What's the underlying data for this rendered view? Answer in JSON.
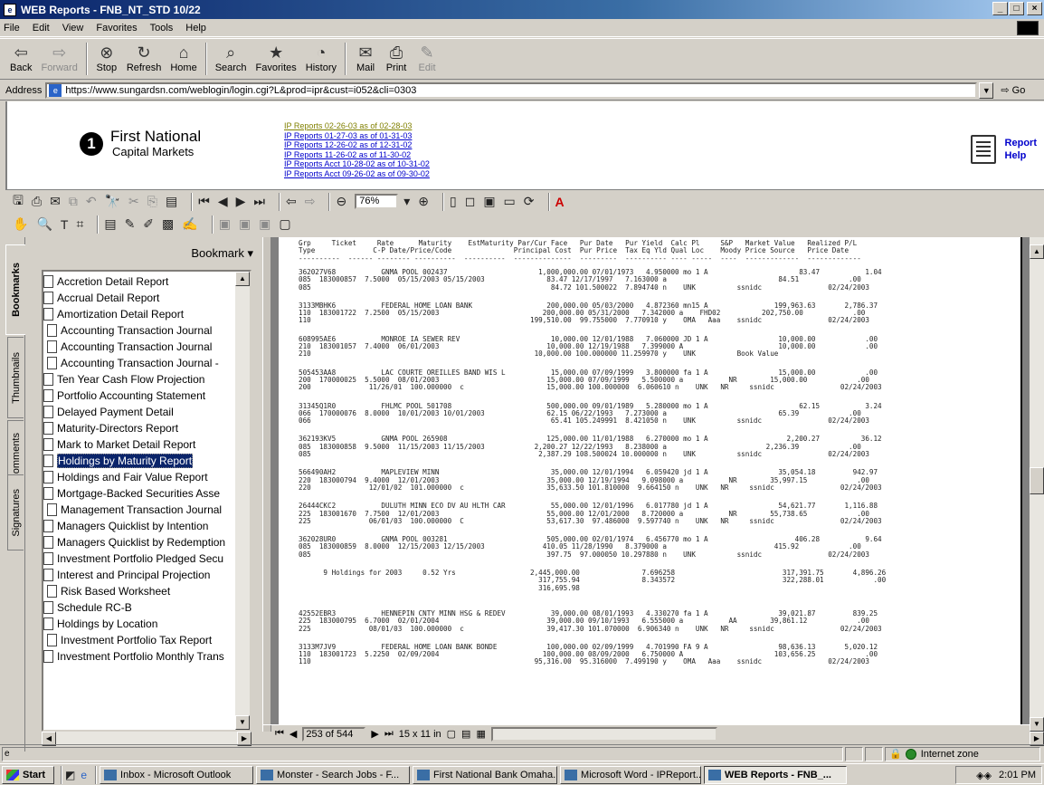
{
  "window": {
    "title": "WEB Reports - FNB_NT_STD 10/22",
    "buttons": [
      "_",
      "□",
      "×"
    ]
  },
  "menu": [
    "File",
    "Edit",
    "View",
    "Favorites",
    "Tools",
    "Help"
  ],
  "toolbar": [
    {
      "label": "Back",
      "glyph": "⇦",
      "disabled": false
    },
    {
      "label": "Forward",
      "glyph": "⇨",
      "disabled": true
    },
    {
      "label": "Stop",
      "glyph": "⊗",
      "disabled": false
    },
    {
      "label": "Refresh",
      "glyph": "↻",
      "disabled": false
    },
    {
      "label": "Home",
      "glyph": "⌂",
      "disabled": false
    },
    {
      "label": "Search",
      "glyph": "⌕",
      "disabled": false
    },
    {
      "label": "Favorites",
      "glyph": "★",
      "disabled": false
    },
    {
      "label": "History",
      "glyph": "◔",
      "disabled": false
    },
    {
      "label": "Mail",
      "glyph": "✉",
      "disabled": false
    },
    {
      "label": "Print",
      "glyph": "⎙",
      "disabled": false
    },
    {
      "label": "Edit",
      "glyph": "✎",
      "disabled": true
    }
  ],
  "address": {
    "label": "Address",
    "url": "https://www.sungardsn.com/weblogin/login.cgi?L&prod=ipr&cust=i052&cli=0303",
    "go": "Go"
  },
  "web": {
    "brand_line1": "First National",
    "brand_line2": "Capital Markets",
    "links": [
      "IP Reports  02-26-03  as of 02-28-03",
      "IP Reports  01-27-03  as of 01-31-03",
      "IP Reports  12-26-02  as of 12-31-02",
      "IP Reports  11-26-02  as of 11-30-02",
      "IP Reports Acct 10-28-02  as of 10-31-02",
      "IP Reports Acct 09-26-02  as of 09-30-02"
    ],
    "help_line1": "Report",
    "help_line2": "Help"
  },
  "acrobat": {
    "zoom": "76%"
  },
  "sidetabs": [
    "Bookmarks",
    "Thumbnails",
    "Comments",
    "Signatures"
  ],
  "bookmarks": {
    "header": "Bookmark ▾",
    "items": [
      {
        "label": "Accretion Detail Report",
        "indent": false,
        "selected": false
      },
      {
        "label": "Accrual Detail Report",
        "indent": false,
        "selected": false
      },
      {
        "label": "Amortization Detail Report",
        "indent": false,
        "selected": false
      },
      {
        "label": "Accounting Transaction Journal",
        "indent": true,
        "selected": false
      },
      {
        "label": "Accounting Transaction Journal",
        "indent": true,
        "selected": false
      },
      {
        "label": "Accounting Transaction Journal -",
        "indent": true,
        "selected": false
      },
      {
        "label": "Ten Year Cash Flow Projection",
        "indent": false,
        "selected": false
      },
      {
        "label": "Portfolio Accounting Statement",
        "indent": false,
        "selected": false
      },
      {
        "label": "Delayed Payment Detail",
        "indent": false,
        "selected": false
      },
      {
        "label": "Maturity-Directors Report",
        "indent": false,
        "selected": false
      },
      {
        "label": "Mark to Market Detail Report",
        "indent": false,
        "selected": false
      },
      {
        "label": "Holdings by Maturity Report",
        "indent": false,
        "selected": true
      },
      {
        "label": "Holdings and Fair Value Report",
        "indent": false,
        "selected": false
      },
      {
        "label": "Mortgage-Backed Securities Asse",
        "indent": false,
        "selected": false
      },
      {
        "label": "Management Transaction Journal",
        "indent": true,
        "selected": false
      },
      {
        "label": "Managers Quicklist by Intention",
        "indent": false,
        "selected": false
      },
      {
        "label": "Managers Quicklist by Redemption",
        "indent": false,
        "selected": false
      },
      {
        "label": "Investment Portfolio Pledged Secu",
        "indent": false,
        "selected": false
      },
      {
        "label": "Interest and Principal Projection",
        "indent": false,
        "selected": false
      },
      {
        "label": "Risk Based Worksheet",
        "indent": true,
        "selected": false
      },
      {
        "label": "Schedule RC-B",
        "indent": false,
        "selected": false
      },
      {
        "label": "Holdings by Location",
        "indent": false,
        "selected": false
      },
      {
        "label": "Investment Portfolio Tax Report",
        "indent": true,
        "selected": false
      },
      {
        "label": "Investment Portfolio Monthly Trans",
        "indent": false,
        "selected": false
      }
    ]
  },
  "report": {
    "header": [
      "Grp     Ticket     Rate      Maturity    EstMaturity Par/Cur Face   Pur Date   Pur Yield  Calc Pl     S&P   Market Value   Realized P/L",
      "Type              C-P Date/Price/Code               Principal Cost  Pur Price  Tax Eq Yld Qual Loc    Moody Price Source   Price Date",
      "----------  ------ -------- ----------  ----------  --------------  ---------  ---------- ---- -----  ----  -------------  -------------"
    ],
    "holdings": [
      [
        "362027V68           GNMA POOL 002437                      1,000,000.00 07/01/1973   4.950000 mo 1 A                      83.47           1.04",
        "085  183000857  7.5000  05/15/2003 05/15/2003               83.47 12/17/1997   7.163000 a                           84.51            .00",
        "085                                                          84.72 101.500022  7.894740 n    UNK          ssnidc                02/24/2003"
      ],
      [
        "3133MBHK6           FEDERAL HOME LOAN BANK                  200,000.00 05/03/2000   4.872360 mn15 A                199,963.63       2,786.37",
        "110  183001722  7.2500  05/15/2003                         200,000.00 05/31/2000   7.342000 a    FHD02          202,750.00            .00",
        "110                                                     199,510.00  99.755000  7.770910 y    OMA   Aaa    ssnidc                02/24/2003"
      ],
      [
        "608995AE6           MONROE IA SEWER REV                      10,000.00 12/01/1988   7.060000 JD 1 A                 10,000.00            .00",
        "210  183001057  7.4000  06/01/2003                          10,000.00 12/19/1988   7.399000 A                       10,000.00            .00",
        "210                                                      10,000.00 100.000000 11.259970 y    UNK          Book Value"
      ],
      [
        "505453AA8           LAC COURTE OREILLES BAND WIS L           15,000.00 07/09/1999   3.800000 fa 1 A                 15,000.00            .00",
        "200  170000025  5.5000  08/01/2003                          15,000.00 07/09/1999   5.500000 a           NR        15,000.00            .00",
        "200              11/26/01  100.000000  c                    15,000.00 100.000000  6.060610 n    UNK   NR     ssnidc                02/24/2003"
      ],
      [
        "31345Q1R0           FHLMC POOL 501708                       500,000.00 09/01/1989   5.280000 mo 1 A                      62.15           3.24",
        "066  170000076  8.0000  10/01/2003 10/01/2003               62.15 06/22/1993   7.273000 a                           65.39            .00",
        "066                                                          65.41 105.249991  8.421050 n    UNK          ssnidc                02/24/2003"
      ],
      [
        "362193KV5           GNMA POOL 265908                        125,000.00 11/01/1988   6.270000 mo 1 A                   2,200.27          36.12",
        "085  183000858  9.5000  11/15/2003 11/15/2003            2,200.27 12/22/1993   8.238000 a                        2,236.39            .00",
        "085                                                       2,387.29 108.500024 10.000000 n    UNK          ssnidc                02/24/2003"
      ],
      [
        "566490AH2           MAPLEVIEW MINN                           35,000.00 12/01/1994   6.059420 jd 1 A                 35,054.18         942.97",
        "220  183000794  9.4000  12/01/2003                          35,000.00 12/19/1994   9.098000 a           NR        35,997.15            .00",
        "220              12/01/02  101.000000  c                    35,633.50 101.810000  9.664150 n    UNK   NR     ssnidc                02/24/2003"
      ],
      [
        "26444CKC2           DULUTH MINN ECO DV AU HLTH CAR           55,000.00 12/01/1996   6.017780 jd 1 A                 54,621.77       1,116.88",
        "225  183001670  7.7500  12/01/2003                          55,000.00 12/01/2000   8.720000 a           NR        55,738.65            .00",
        "225              06/01/03  100.000000  C                    53,617.30  97.486000  9.597740 n    UNK   NR     ssnidc                02/24/2003"
      ],
      [
        "362028UR0           GNMA POOL 003281                        505,000.00 02/01/1974   6.456770 mo 1 A                     406.28           9.64",
        "085  183000859  8.0000  12/15/2003 12/15/2003              410.05 11/28/1990   8.379000 a                          415.92            .00",
        "085                                                         397.75  97.000050 10.297880 n    UNK          ssnidc                02/24/2003"
      ]
    ],
    "subtotal": [
      "      9 Holdings for 2003     0.52 Yrs                  2,445,000.00               7.696258                          317,391.75       4,896.26",
      "                                                          317,755.94               8.343572                          322,288.01            .00",
      "                                                          316,695.98"
    ],
    "holdings_2004": [
      [
        "42552EBR3           HENNEPIN CNTY MINN HSG & REDEV           39,000.00 08/01/1993   4.330270 fa 1 A                 39,021.87         839.25",
        "225  183000795  6.7000  02/01/2004                          39,000.00 09/10/1993   6.555000 a           AA        39,861.12            .00",
        "225              08/01/03  100.000000  c                    39,417.30 101.070000  6.906340 n    UNK   NR     ssnidc                02/24/2003"
      ],
      [
        "3133M7JV9           FEDERAL HOME LOAN BANK BONDE            100,000.00 02/09/1999   4.701990 FA 9 A                 98,636.13       5,020.12",
        "110  183001723  5.2250  02/09/2004                         100,000.00 08/09/2000   6.750000 A                      103,656.25            .00",
        "110                                                      95,316.00  95.316000  7.499190 y    OMA   Aaa    ssnidc                02/24/2003"
      ]
    ]
  },
  "docstatus": {
    "page": "253 of 544",
    "size": "15 x 11 in"
  },
  "iestatus": {
    "zone": "Internet zone"
  },
  "taskbar": {
    "start": "Start",
    "tasks": [
      {
        "label": "Inbox - Microsoft Outlook",
        "active": false
      },
      {
        "label": "Monster - Search Jobs - F...",
        "active": false
      },
      {
        "label": "First National Bank Omaha...",
        "active": false
      },
      {
        "label": "Microsoft Word - IPReport...",
        "active": false
      },
      {
        "label": "WEB Reports - FNB_...",
        "active": true
      }
    ],
    "clock": "2:01 PM"
  }
}
